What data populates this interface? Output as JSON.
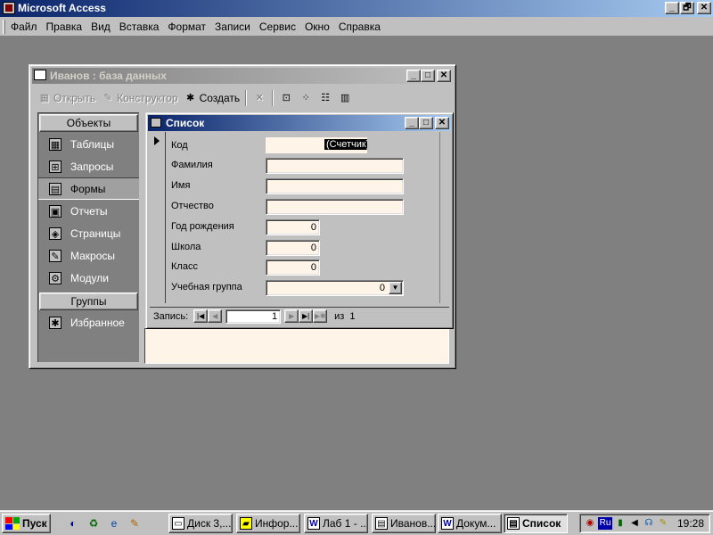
{
  "app": {
    "title": "Microsoft Access",
    "controls": {
      "minimize": "_",
      "maximize": "🗗",
      "close": "✕"
    }
  },
  "menu": {
    "items": [
      "Файл",
      "Правка",
      "Вид",
      "Вставка",
      "Формат",
      "Записи",
      "Сервис",
      "Окно",
      "Справка"
    ]
  },
  "db_window": {
    "title": "Иванов : база данных",
    "toolbar": {
      "open_label": "Открыть",
      "design_label": "Конструктор",
      "create_label": "Создать"
    },
    "objects_header": "Объекты",
    "objects": [
      {
        "label": "Таблицы",
        "icon": "table-icon",
        "glyph": "▦"
      },
      {
        "label": "Запросы",
        "icon": "query-icon",
        "glyph": "⊞"
      },
      {
        "label": "Формы",
        "icon": "form-icon",
        "glyph": "▤"
      },
      {
        "label": "Отчеты",
        "icon": "report-icon",
        "glyph": "▣"
      },
      {
        "label": "Страницы",
        "icon": "page-icon",
        "glyph": "◈"
      },
      {
        "label": "Макросы",
        "icon": "macro-icon",
        "glyph": "✎"
      },
      {
        "label": "Модули",
        "icon": "module-icon",
        "glyph": "⚙"
      }
    ],
    "selected_object": "Формы",
    "groups_header": "Группы",
    "groups": [
      {
        "label": "Избранное",
        "icon": "favorites-icon",
        "glyph": "✱"
      }
    ]
  },
  "form": {
    "title": "Список",
    "fields": {
      "kod": {
        "label": "Код",
        "value": "(Счетчик)"
      },
      "familiya": {
        "label": "Фамилия",
        "value": ""
      },
      "imya": {
        "label": "Имя",
        "value": ""
      },
      "otchestvo": {
        "label": "Отчество",
        "value": ""
      },
      "god": {
        "label": "Год рождения",
        "value": "0"
      },
      "shkola": {
        "label": "Школа",
        "value": "0"
      },
      "klass": {
        "label": "Класс",
        "value": "0"
      },
      "gruppa": {
        "label": "Учебная группа",
        "value": "0"
      }
    },
    "nav": {
      "label": "Запись:",
      "current": "1",
      "of_label": "из",
      "total": "1"
    }
  },
  "taskbar": {
    "start_label": "Пуск",
    "tasks": [
      {
        "label": "Диск 3,...",
        "icon": "disk-icon",
        "glyph": "▭"
      },
      {
        "label": "Инфор...",
        "icon": "folder-icon",
        "glyph": "▰"
      },
      {
        "label": "Лаб 1 - ...",
        "icon": "word-icon",
        "glyph": "W"
      },
      {
        "label": "Иванов...",
        "icon": "database-icon",
        "glyph": "▤"
      },
      {
        "label": "Докум...",
        "icon": "word-icon",
        "glyph": "W"
      },
      {
        "label": "Список",
        "icon": "form-icon",
        "glyph": "▤",
        "active": true
      }
    ],
    "tray": {
      "language": "Ru",
      "clock": "19:28"
    }
  }
}
